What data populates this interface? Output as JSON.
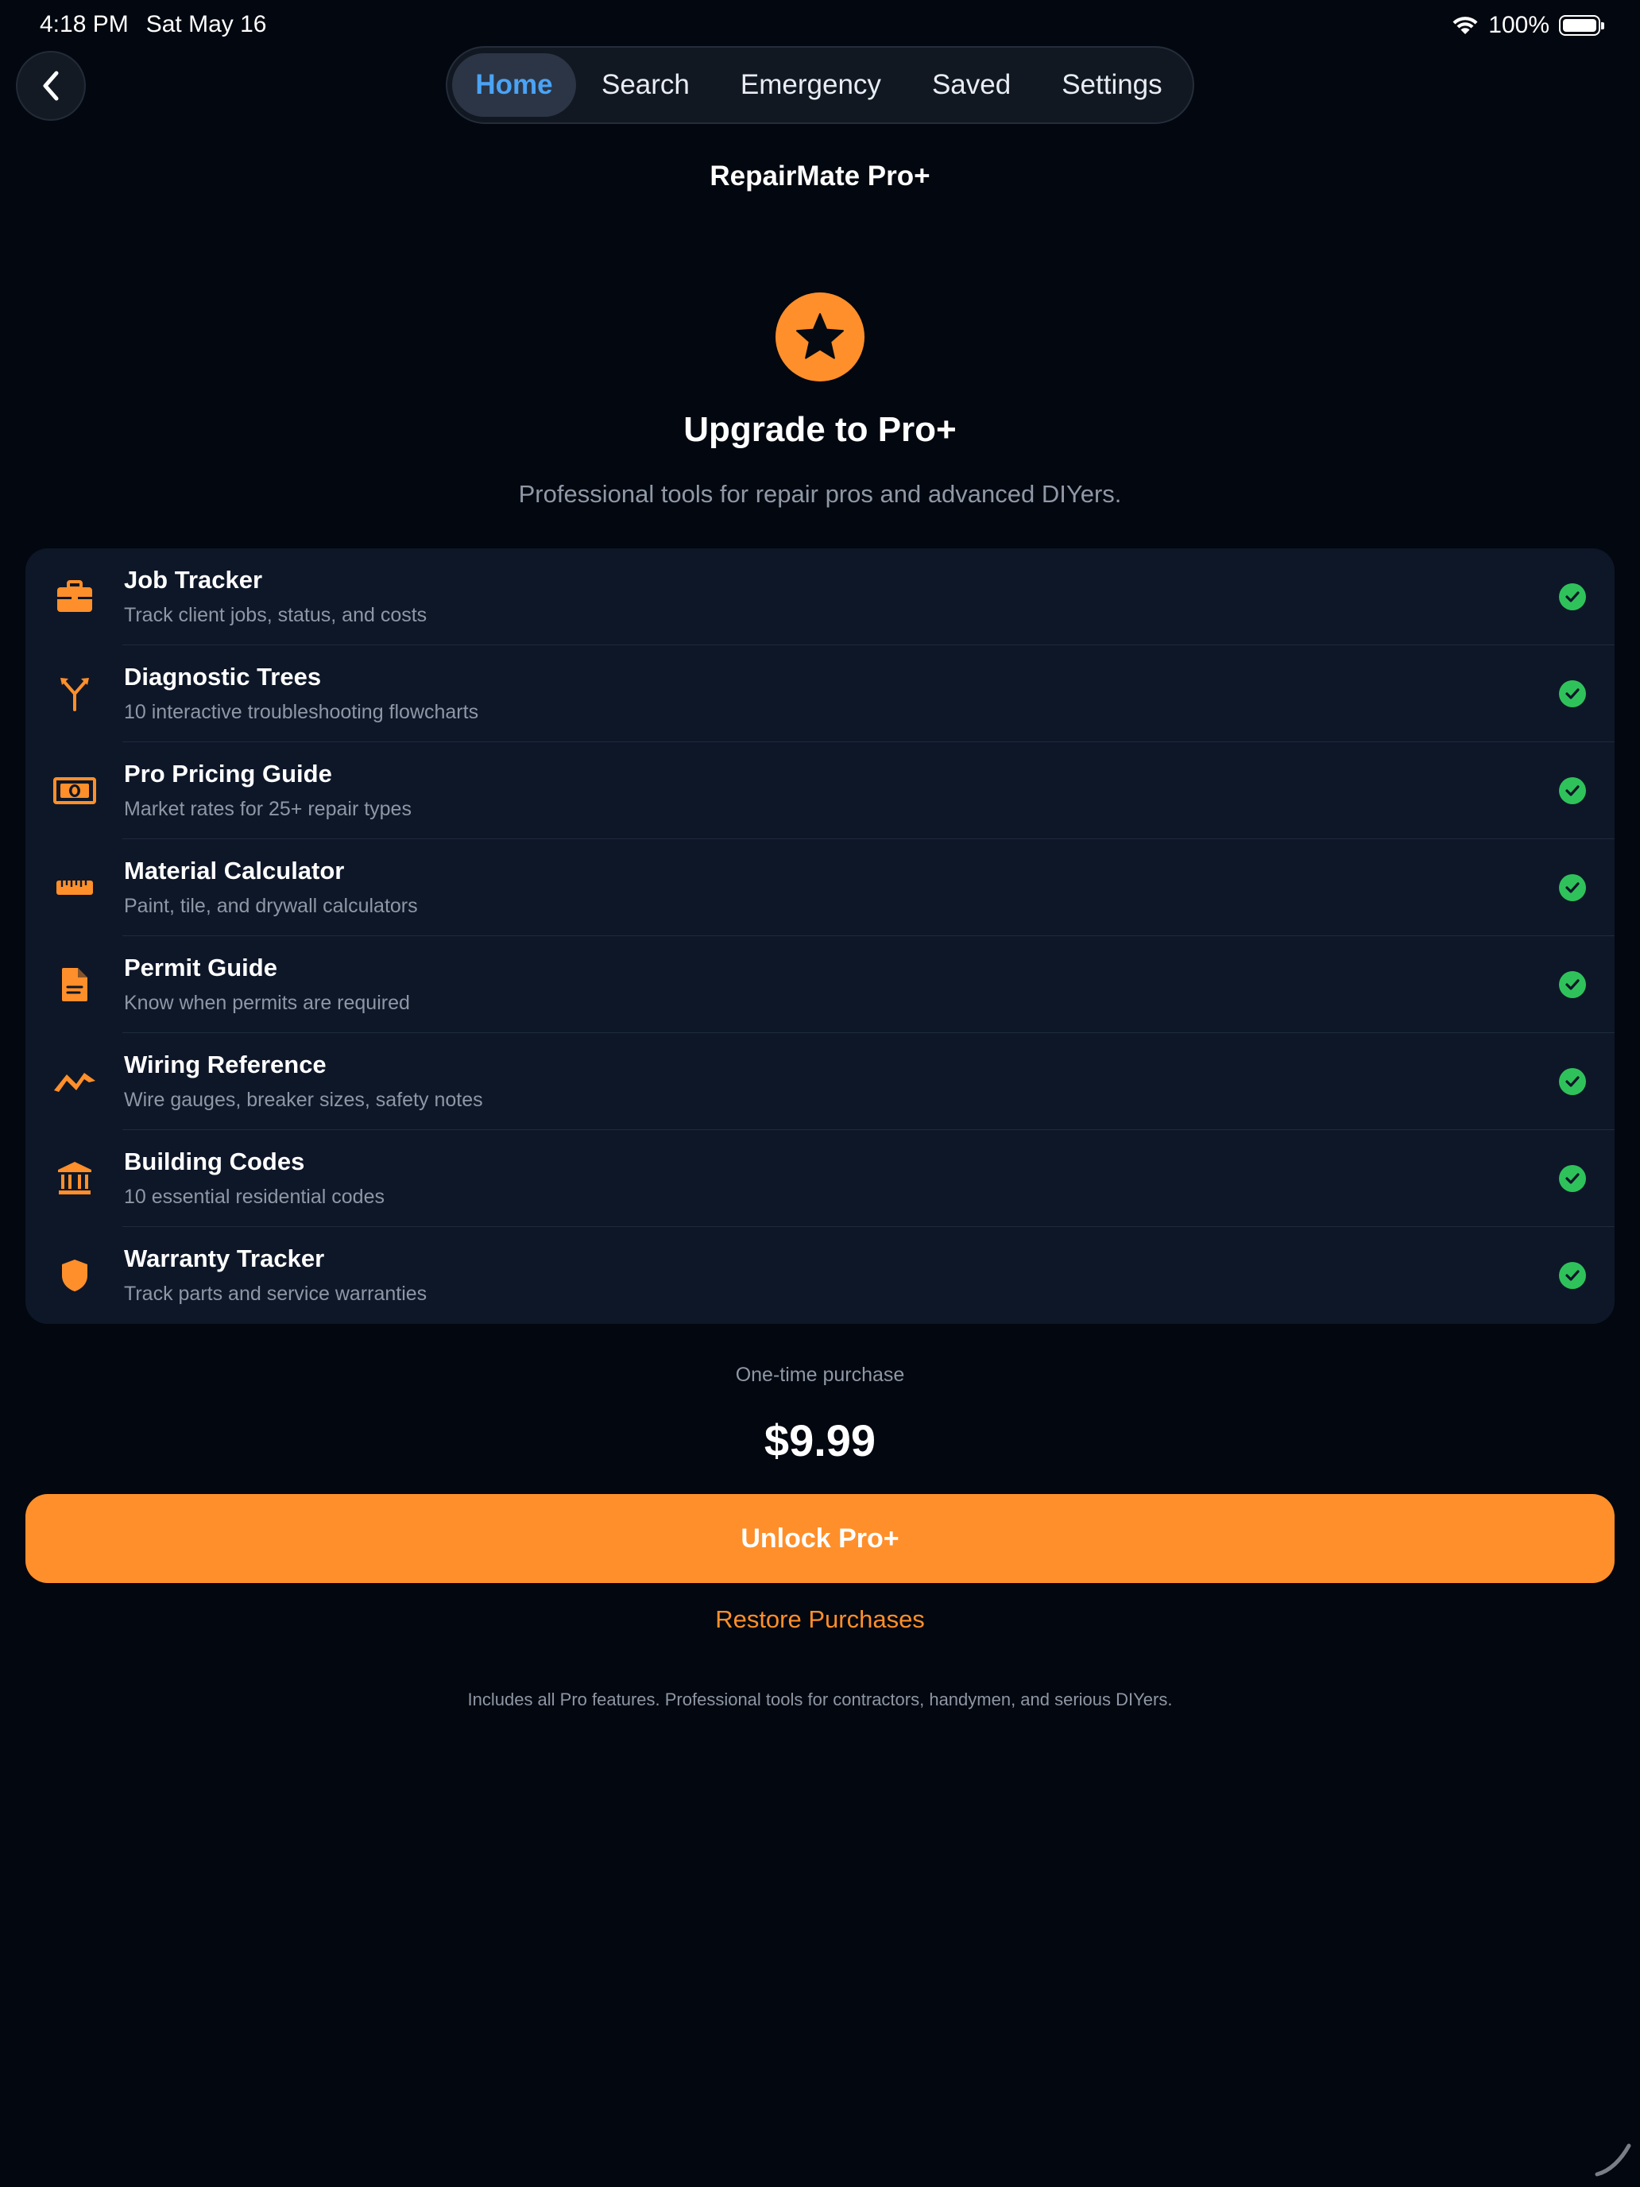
{
  "status_bar": {
    "time": "4:18 PM",
    "date": "Sat May 16",
    "battery": "100%"
  },
  "nav": {
    "tabs": [
      {
        "label": "Home",
        "active": true
      },
      {
        "label": "Search",
        "active": false
      },
      {
        "label": "Emergency",
        "active": false
      },
      {
        "label": "Saved",
        "active": false
      },
      {
        "label": "Settings",
        "active": false
      }
    ]
  },
  "header": {
    "title": "RepairMate Pro+"
  },
  "hero": {
    "icon": "star-icon",
    "headline": "Upgrade to Pro+",
    "subheadline": "Professional tools for repair pros and advanced DIYers."
  },
  "features": [
    {
      "icon": "briefcase-icon",
      "title": "Job Tracker",
      "description": "Track client jobs, status, and costs",
      "included": true
    },
    {
      "icon": "branch-icon",
      "title": "Diagnostic Trees",
      "description": "10 interactive troubleshooting flowcharts",
      "included": true
    },
    {
      "icon": "banknote-icon",
      "title": "Pro Pricing Guide",
      "description": "Market rates for 25+ repair types",
      "included": true
    },
    {
      "icon": "ruler-icon",
      "title": "Material Calculator",
      "description": "Paint, tile, and drywall calculators",
      "included": true
    },
    {
      "icon": "document-icon",
      "title": "Permit Guide",
      "description": "Know when permits are required",
      "included": true
    },
    {
      "icon": "bolt-icon",
      "title": "Wiring Reference",
      "description": "Wire gauges, breaker sizes, safety notes",
      "included": true
    },
    {
      "icon": "building-columns-icon",
      "title": "Building Codes",
      "description": "10 essential residential codes",
      "included": true
    },
    {
      "icon": "shield-icon",
      "title": "Warranty Tracker",
      "description": "Track parts and service warranties",
      "included": true
    }
  ],
  "purchase": {
    "label": "One-time purchase",
    "price": "$9.99",
    "unlock_label": "Unlock Pro+",
    "restore_label": "Restore Purchases",
    "footnote": "Includes all Pro features. Professional tools for contractors, handymen, and serious DIYers."
  },
  "colors": {
    "accent": "#ff8f2a",
    "active_tab": "#4aa3f5",
    "check": "#2fc25b",
    "background": "#03070f",
    "card": "#0e1728"
  }
}
